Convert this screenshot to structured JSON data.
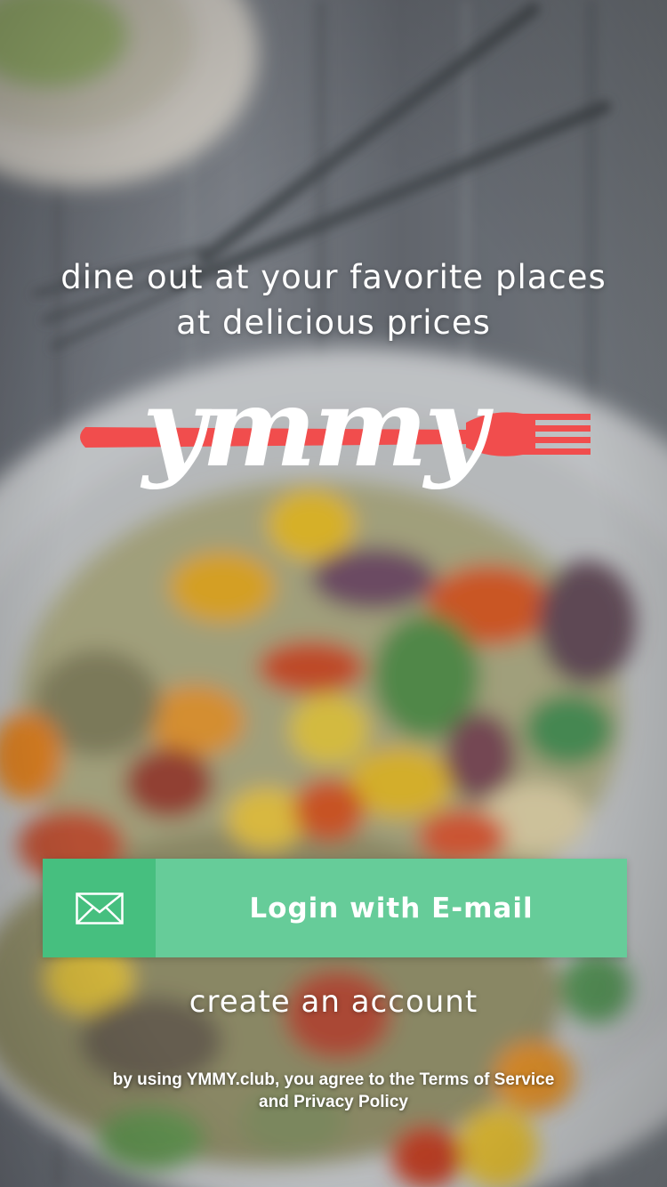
{
  "tagline": {
    "line1": "dine out at your favorite places",
    "line2": "at delicious prices"
  },
  "logo": {
    "text": "ymmy"
  },
  "login_button": {
    "label": "Login with E-mail",
    "icon": "envelope-icon"
  },
  "create_account": {
    "label": "create an account"
  },
  "legal": {
    "line1": "by using YMMY.club, you agree to the Terms of Service",
    "line2": "and Privacy Policy"
  },
  "colors": {
    "brand_red": "#f14d4d",
    "button_green": "#66cc99",
    "button_green_dark": "#46bf7f",
    "text": "#ffffff"
  }
}
